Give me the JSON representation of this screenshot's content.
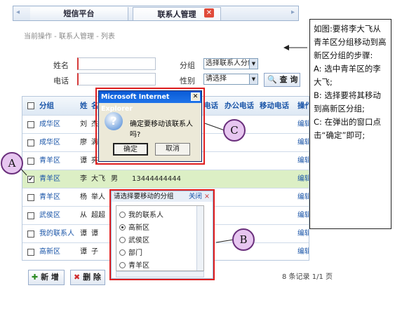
{
  "tabs": [
    {
      "label": "短信平台"
    },
    {
      "label": "联系人管理"
    }
  ],
  "breadcrumb": "当前操作 - 联系人管理 - 列表",
  "form": {
    "name_label": "姓名",
    "phone_label": "电话",
    "group_label": "分组",
    "group_select": "选择联系人分组",
    "gender_label": "性别",
    "gender_select": "请选择",
    "query_button": "查 询"
  },
  "table": {
    "headers": [
      "分组",
      "姓",
      "名",
      "",
      "电话",
      "办公电话",
      "移动电话",
      "操作"
    ],
    "rows": [
      {
        "group": "成华区",
        "surname": "刘",
        "name": "杰",
        "gender": "",
        "phone": "",
        "action": "编辑"
      },
      {
        "group": "成华区",
        "surname": "廖",
        "name": "满",
        "gender": "",
        "phone": "",
        "action": "编辑"
      },
      {
        "group": "青羊区",
        "surname": "谭",
        "name": "亮",
        "gender": "",
        "phone": "",
        "action": "编辑"
      },
      {
        "group": "青羊区",
        "surname": "李",
        "name": "大飞",
        "gender": "男",
        "phone": "13444444444",
        "action": "编辑",
        "selected": true
      },
      {
        "group": "青羊区",
        "surname": "杨",
        "name": "举人",
        "gender": "",
        "phone": "",
        "action": "编辑"
      },
      {
        "group": "武侯区",
        "surname": "从",
        "name": "超超",
        "gender": "",
        "phone": "",
        "action": "编辑"
      },
      {
        "group": "我的联系人",
        "surname": "谭",
        "name": "谭",
        "gender": "",
        "phone": "",
        "action": "编辑"
      },
      {
        "group": "高新区",
        "surname": "谭",
        "name": "子",
        "gender": "",
        "phone": "",
        "action": "编辑 删除"
      }
    ]
  },
  "buttons": {
    "add": "新 增",
    "delete": "删 除"
  },
  "pager": "8 条记录 1/1 页",
  "ie_dialog": {
    "title": "Microsoft Internet Explorer",
    "message": "确定要移动该联系人吗?",
    "ok": "确定",
    "cancel": "取消"
  },
  "group_popup": {
    "title": "请选择要移动的分组",
    "close": "关闭",
    "items": [
      {
        "label": "我的联系人",
        "checked": false
      },
      {
        "label": "高新区",
        "checked": true
      },
      {
        "label": "武侯区",
        "checked": false
      },
      {
        "label": "部门",
        "checked": false
      },
      {
        "label": "青羊区",
        "checked": false
      }
    ]
  },
  "callouts": {
    "a": "A",
    "b": "B",
    "c": "C"
  },
  "note": {
    "intro": "如图:要将李大飞从青羊区分组移动到高新区分组的步骤:",
    "step_a": "A: 选中青羊区的李大飞;",
    "step_b": "B: 选择要将其移动到高新区分组;",
    "step_c": "C: 在弹出的窗口点击“确定”即可;"
  },
  "colors": {
    "accent": "#1a55a8",
    "highlight": "#dcefc5",
    "callout_fill": "#e7c6f0",
    "red_frame": "#e01e1e"
  }
}
